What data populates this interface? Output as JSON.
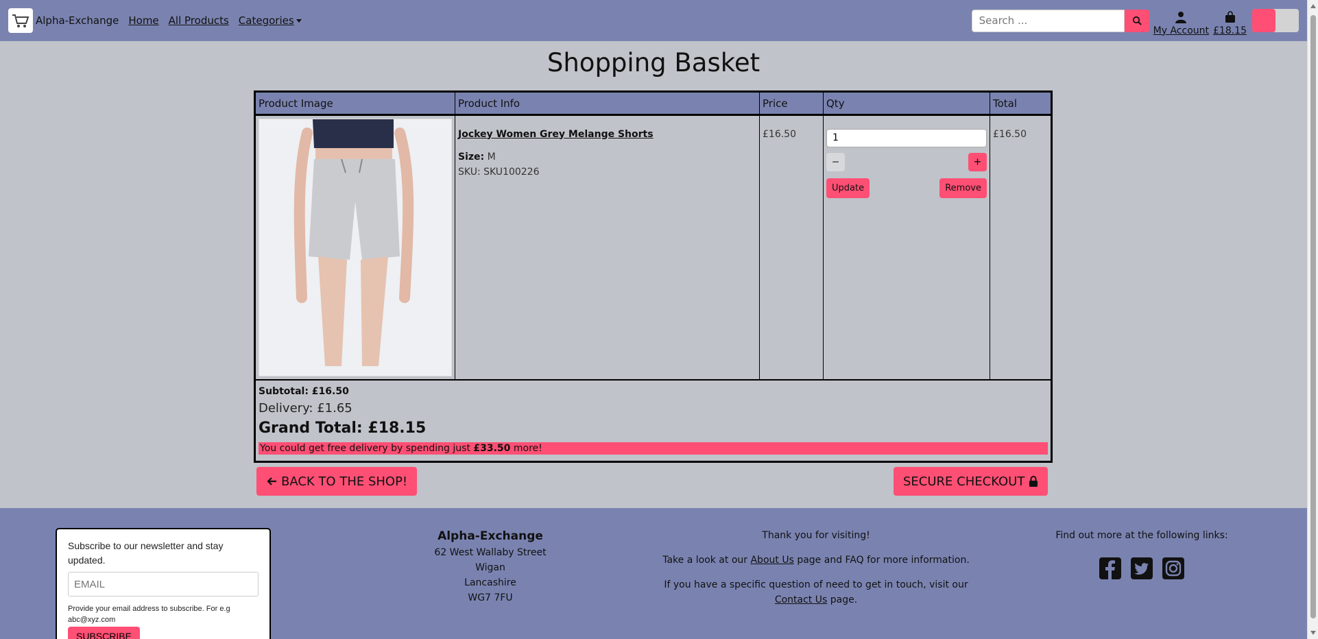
{
  "nav": {
    "brand": "Alpha-Exchange",
    "links": [
      "Home",
      "All Products",
      "Categories"
    ],
    "search_placeholder": "Search ...",
    "account_label": "My Account",
    "basket_total": "£18.15"
  },
  "page_title": "Shopping Basket",
  "basket": {
    "headers": [
      "Product Image",
      "Product Info",
      "Price",
      "Qty",
      "Total"
    ],
    "item": {
      "name": "Jockey Women Grey Melange Shorts",
      "size_label": "Size:",
      "size_value": "M",
      "sku": "SKU: SKU100226",
      "price": "£16.50",
      "qty": "1",
      "minus": "−",
      "plus": "+",
      "update": "Update",
      "remove": "Remove",
      "total": "£16.50"
    },
    "subtotal": "Subtotal: £16.50",
    "delivery": "Delivery: £1.65",
    "grand_total": "Grand Total: £18.15",
    "free_prefix": "You could get free delivery by spending just ",
    "free_amount": "£33.50",
    "free_suffix": " more!"
  },
  "buttons": {
    "back": "BACK TO THE SHOP!",
    "checkout": "SECURE CHECKOUT"
  },
  "footer": {
    "newsletter_text": "Subscribe to our newsletter and stay updated.",
    "email_placeholder": "EMAIL",
    "help_text": "Provide your email address to subscribe. For e.g abc@xyz.com",
    "subscribe": "SUBSCRIBE",
    "address": {
      "name": "Alpha-Exchange",
      "line1": "62 West Wallaby Street",
      "line2": "Wigan",
      "line3": "Lancashire",
      "line4": "WG7 7FU"
    },
    "thanks": "Thank you for visiting!",
    "about_prefix": "Take a look at our ",
    "about_link": "About Us",
    "about_suffix": " page and FAQ for more information.",
    "contact_prefix": "If you have a specific question of need to get in touch, visit our ",
    "contact_link": "Contact Us",
    "contact_suffix": " page.",
    "links_heading": "Find out more at the following links:"
  },
  "colors": {
    "nav": "#7a83b0",
    "accent": "#ff4f74",
    "background": "#c0c3c9"
  }
}
